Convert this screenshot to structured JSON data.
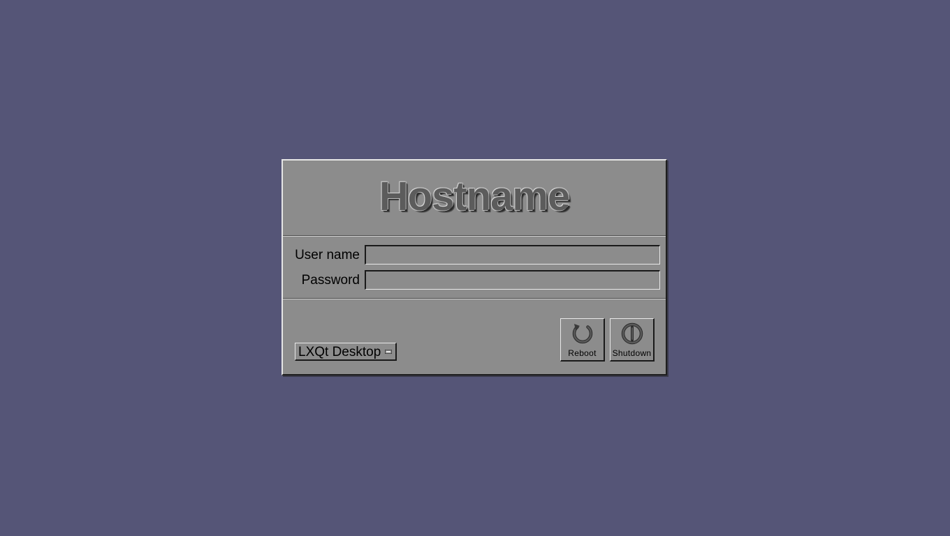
{
  "panel": {
    "hostname": "Hostname"
  },
  "form": {
    "username_label": "User name",
    "username_value": "",
    "password_label": "Password",
    "password_value": ""
  },
  "session": {
    "selected": "LXQt Desktop"
  },
  "buttons": {
    "reboot_label": "Reboot",
    "reboot_icon": "reboot-icon",
    "shutdown_label": "Shutdown",
    "shutdown_icon": "power-icon"
  },
  "colors": {
    "desktop_background": "#555577",
    "panel_background": "#8c8c8c"
  }
}
